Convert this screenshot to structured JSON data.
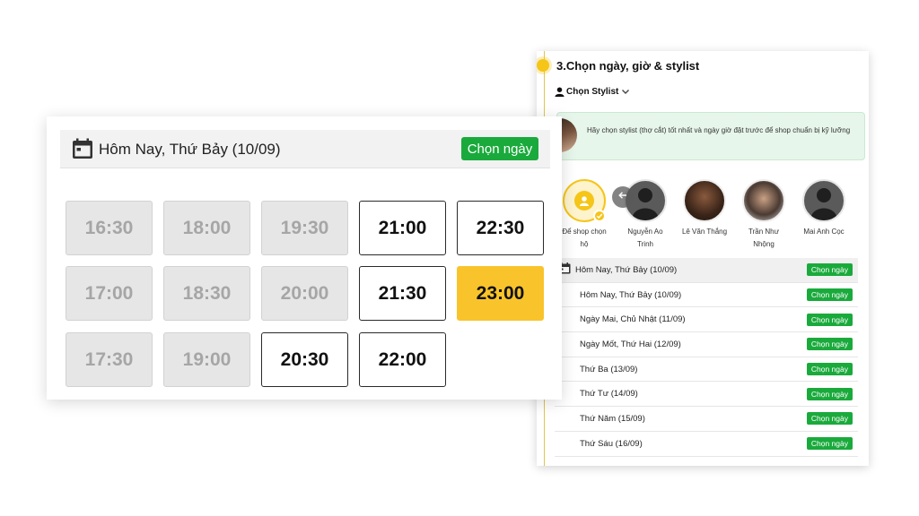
{
  "left": {
    "header_title": "Hôm Nay, Thứ Bảy (10/09)",
    "choose_button": "Chọn ngày",
    "slots": [
      {
        "time": "16:30",
        "state": "disabled"
      },
      {
        "time": "18:00",
        "state": "disabled"
      },
      {
        "time": "19:30",
        "state": "disabled"
      },
      {
        "time": "21:00",
        "state": "available"
      },
      {
        "time": "22:30",
        "state": "available"
      },
      {
        "time": "17:00",
        "state": "disabled"
      },
      {
        "time": "18:30",
        "state": "disabled"
      },
      {
        "time": "20:00",
        "state": "disabled"
      },
      {
        "time": "21:30",
        "state": "available"
      },
      {
        "time": "23:00",
        "state": "selected"
      },
      {
        "time": "17:30",
        "state": "disabled"
      },
      {
        "time": "19:00",
        "state": "disabled"
      },
      {
        "time": "20:30",
        "state": "available"
      },
      {
        "time": "22:00",
        "state": "available"
      }
    ]
  },
  "right": {
    "step_title": "3.Chọn ngày, giờ & stylist",
    "choose_stylist": "Chọn Stylist",
    "notice": "Hãy chọn stylist (thợ cắt) tốt nhất và ngày giờ đặt trước để shop chuẩn bị kỹ lưỡng",
    "stylists": [
      {
        "line1": "Để shop chọn",
        "line2": "hộ"
      },
      {
        "line1": "Nguyễn Ao",
        "line2": "Trinh"
      },
      {
        "line1": "Lê Văn Thắng",
        "line2": ""
      },
      {
        "line1": "Trần Như",
        "line2": "Nhộng"
      },
      {
        "line1": "Mai Anh Cọc",
        "line2": ""
      }
    ],
    "date_header": "Hôm Nay, Thứ Bảy (10/09)",
    "choose_button": "Chọn ngày",
    "dates": [
      "Hôm Nay, Thứ Bảy (10/09)",
      "Ngày Mai, Chủ Nhật (11/09)",
      "Ngày Mốt, Thứ Hai (12/09)",
      "Thứ Ba (13/09)",
      "Thứ Tư (14/09)",
      "Thứ Năm (15/09)",
      "Thứ Sáu (16/09)"
    ]
  },
  "colors": {
    "accent_yellow": "#f9c42b",
    "green_button": "#1aaa3c",
    "disabled_slot": "#e6e6e6"
  }
}
